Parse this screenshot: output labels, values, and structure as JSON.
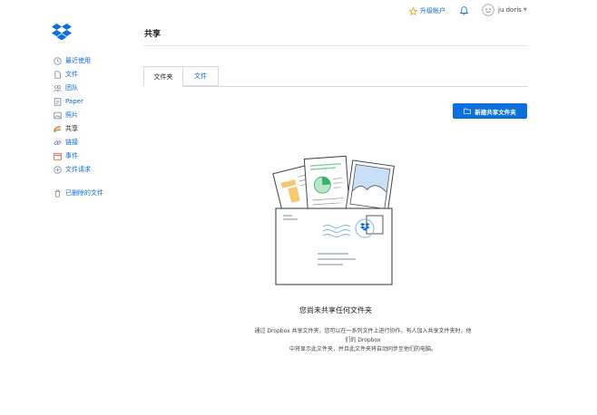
{
  "sidebar": {
    "items": [
      {
        "label": "最近使用",
        "icon": "clock-icon"
      },
      {
        "label": "文件",
        "icon": "file-icon"
      },
      {
        "label": "团队",
        "icon": "team-icon"
      },
      {
        "label": "Paper",
        "icon": "paper-icon"
      },
      {
        "label": "照片",
        "icon": "photo-icon"
      },
      {
        "label": "共享",
        "icon": "share-icon"
      },
      {
        "label": "链接",
        "icon": "link-icon"
      },
      {
        "label": "事件",
        "icon": "calendar-icon"
      },
      {
        "label": "文件请求",
        "icon": "file-request-icon"
      },
      {
        "label": "已删除的文件",
        "icon": "trash-icon"
      }
    ],
    "active": "共享"
  },
  "header": {
    "title": "共享",
    "upgrade_label": "升级帐户",
    "user_name": "ju doris"
  },
  "tabs": [
    {
      "label": "文件夹",
      "active": true
    },
    {
      "label": "文件",
      "active": false
    }
  ],
  "actions": {
    "new_shared_folder": "新建共享文件夹"
  },
  "empty_state": {
    "title": "您尚未共享任何文件夹",
    "description_line1": "通过 Dropbox 共享文件夹，您可以在一系列文件上进行协作。有人加入共享文件夹时，他们的 Dropbox",
    "description_line2": "中将显示此文件夹，并且此文件夹将自动同步至他们的电脑。"
  },
  "colors": {
    "accent": "#0d6fdb",
    "link": "#0e69d6",
    "text": "#1e1919"
  }
}
